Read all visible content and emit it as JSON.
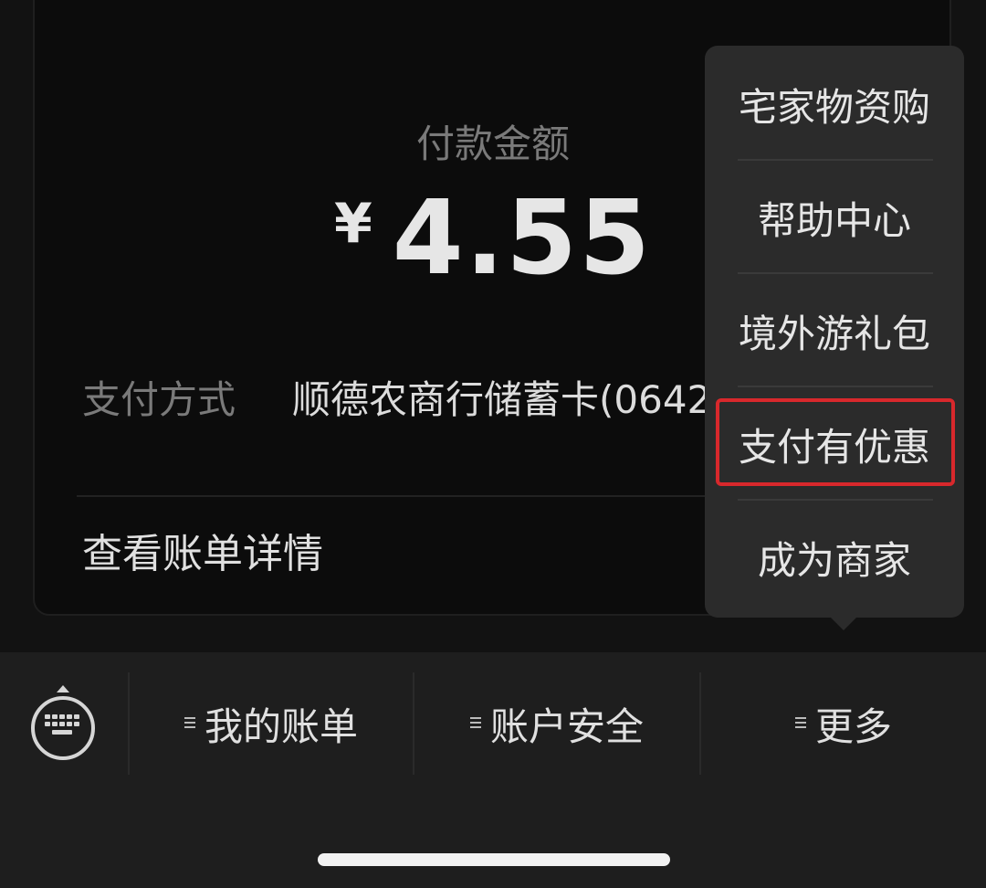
{
  "payment": {
    "amount_label": "付款金额",
    "currency": "¥",
    "amount": "4.55",
    "method_label": "支付方式",
    "method_value": "顺德农商行储蓄卡(0642",
    "bill_details": "查看账单详情"
  },
  "popup_menu": {
    "items": [
      {
        "label": "宅家物资购"
      },
      {
        "label": "帮助中心"
      },
      {
        "label": "境外游礼包"
      },
      {
        "label": "支付有优惠"
      },
      {
        "label": "成为商家"
      }
    ],
    "highlighted_item": "支付有优惠",
    "highlight_color": "#d8282c"
  },
  "bottom_bar": {
    "keyboard_icon": "keyboard-icon",
    "tabs": [
      {
        "label": "我的账单"
      },
      {
        "label": "账户安全"
      },
      {
        "label": "更多"
      }
    ]
  },
  "colors": {
    "background": "#121212",
    "card": "#0c0c0c",
    "popup": "#2b2b2b",
    "bottom_bar": "#1e1e1e"
  }
}
